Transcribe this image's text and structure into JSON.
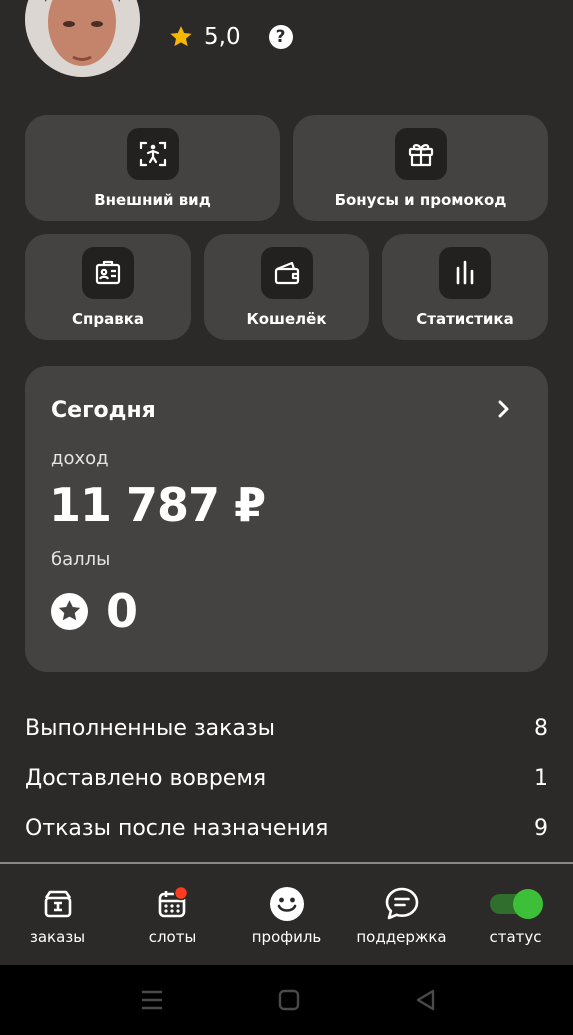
{
  "profile": {
    "rating": "5,0",
    "help_label": "?"
  },
  "tiles": [
    {
      "label": "Внешний вид",
      "icon": "person-frame-icon"
    },
    {
      "label": "Бонусы и промокод",
      "icon": "gift-icon"
    },
    {
      "label": "Справка",
      "icon": "id-card-icon"
    },
    {
      "label": "Кошелёк",
      "icon": "wallet-icon"
    },
    {
      "label": "Статистика",
      "icon": "bar-chart-icon"
    }
  ],
  "today": {
    "title": "Сегодня",
    "income_label": "доход",
    "income_value": "11 787 ₽",
    "points_label": "баллы",
    "points_value": "0"
  },
  "stats": [
    {
      "label": "Выполненные заказы",
      "value": "8"
    },
    {
      "label": "Доставлено вовремя",
      "value": "1"
    },
    {
      "label": "Отказы после назначения",
      "value": "9"
    }
  ],
  "tabs": [
    {
      "label": "заказы",
      "icon": "box-icon"
    },
    {
      "label": "слоты",
      "icon": "calendar-icon"
    },
    {
      "label": "профиль",
      "icon": "smiley-icon"
    },
    {
      "label": "поддержка",
      "icon": "chat-icon"
    },
    {
      "label": "статус",
      "icon": "toggle-icon"
    }
  ],
  "colors": {
    "background": "#2c2a29",
    "card": "#454342",
    "star": "#f5b800",
    "toggle_on": "#3dbf3a",
    "badge": "#ff3b1f"
  }
}
